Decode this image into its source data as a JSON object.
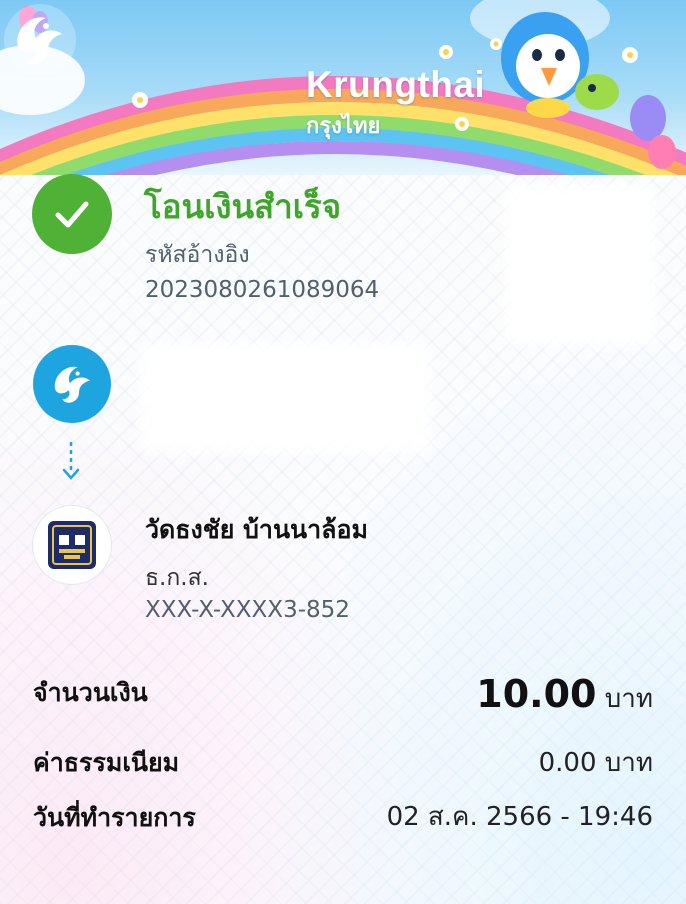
{
  "brand": {
    "name": "Krungthai",
    "name_th": "กรุงไทย"
  },
  "status": {
    "title": "โอนเงินสำเร็จ",
    "ref_label": "รหัสอ้างอิง",
    "ref_number": "2023080261089064"
  },
  "receiver": {
    "name": "วัดธงชัย บ้านนาล้อม",
    "bank": "ธ.ก.ส.",
    "account": "XXX-X-XXXX3-852"
  },
  "details": {
    "amount_label": "จำนวนเงิน",
    "amount_value": "10.00",
    "amount_unit": "บาท",
    "fee_label": "ค่าธรรมเนียม",
    "fee_value": "0.00 บาท",
    "date_label": "วันที่ทำรายการ",
    "date_value": "02 ส.ค. 2566 - 19:46"
  },
  "colors": {
    "success_green": "#4fb236",
    "ktb_blue": "#1ea5e0",
    "baac_navy": "#1d2b6b"
  },
  "icons": [
    "checkmark-icon",
    "krungthai-bird-icon",
    "arrow-down-icon",
    "baac-logo-icon"
  ]
}
